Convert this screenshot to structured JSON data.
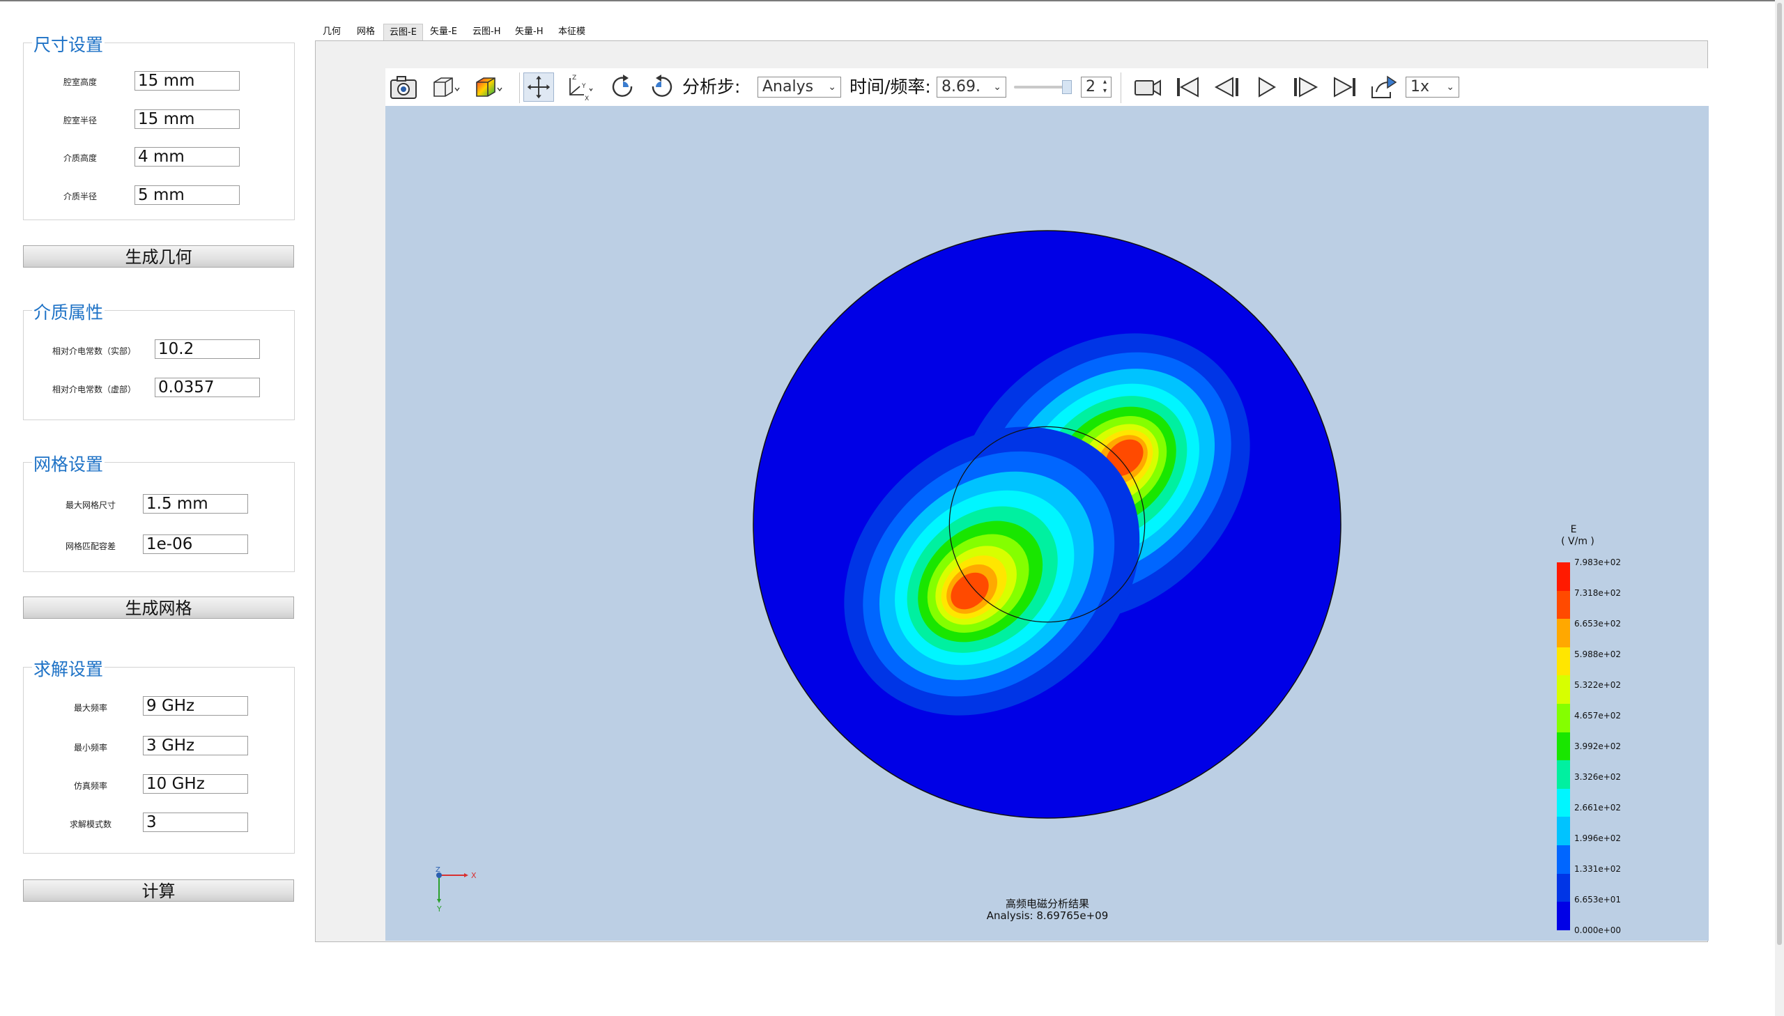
{
  "size_group": {
    "title": "尺寸设置",
    "rows": [
      {
        "label": "腔室高度",
        "value": "15 mm"
      },
      {
        "label": "腔室半径",
        "value": "15 mm"
      },
      {
        "label": "介质高度",
        "value": "4 mm"
      },
      {
        "label": "介质半径",
        "value": "5 mm"
      }
    ]
  },
  "gen_geometry_label": "生成几何",
  "material_group": {
    "title": "介质属性",
    "rows": [
      {
        "label": "相对介电常数（实部）",
        "value": "10.2"
      },
      {
        "label": "相对介电常数（虚部）",
        "value": "0.0357"
      }
    ]
  },
  "mesh_group": {
    "title": "网格设置",
    "rows": [
      {
        "label": "最大网格尺寸",
        "value": "1.5 mm"
      },
      {
        "label": "网格匹配容差",
        "value": "1e-06"
      }
    ]
  },
  "gen_mesh_label": "生成网格",
  "solve_group": {
    "title": "求解设置",
    "rows": [
      {
        "label": "最大频率",
        "value": "9 GHz"
      },
      {
        "label": "最小频率",
        "value": "3 GHz"
      },
      {
        "label": "仿真频率",
        "value": "10 GHz"
      },
      {
        "label": "求解模式数",
        "value": "3"
      }
    ]
  },
  "compute_label": "计算",
  "tabs": [
    "几何",
    "网格",
    "云图-E",
    "矢量-E",
    "云图-H",
    "矢量-H",
    "本征模"
  ],
  "active_tab": "云图-E",
  "toolbar": {
    "step_label": "分析步:",
    "step_value": "Analys",
    "time_label": "时间/频率:",
    "time_value": "8.69.",
    "spin_value": "2",
    "speed_value": "1x",
    "icons": [
      "camera-icon",
      "view-cube-icon",
      "color-cube-icon",
      "pan-move-icon",
      "axes-icon",
      "rotate-cw-icon",
      "rotate-ccw-icon",
      "record-video-icon",
      "first-frame-icon",
      "prev-frame-icon",
      "play-icon",
      "next-frame-icon",
      "last-frame-icon",
      "export-icon"
    ]
  },
  "legend": {
    "quantity": "E",
    "unit": "( V/m )",
    "labels": [
      "7.983e+02",
      "7.318e+02",
      "6.653e+02",
      "5.988e+02",
      "5.322e+02",
      "4.657e+02",
      "3.992e+02",
      "3.326e+02",
      "2.661e+02",
      "1.996e+02",
      "1.331e+02",
      "6.653e+01",
      "0.000e+00"
    ],
    "colors": [
      "#ff1a00",
      "#ff4a00",
      "#ffa800",
      "#ffe600",
      "#d7ff00",
      "#84ff00",
      "#19e600",
      "#00f0a0",
      "#00f6ff",
      "#00c3ff",
      "#0066ff",
      "#0035e6",
      "#0000e6"
    ]
  },
  "axis_triad": {
    "x": "X",
    "y": "Y",
    "z": "Z"
  },
  "caption": {
    "title": "高频电磁分析结果",
    "subtitle": "Analysis: 8.69765e+09"
  }
}
